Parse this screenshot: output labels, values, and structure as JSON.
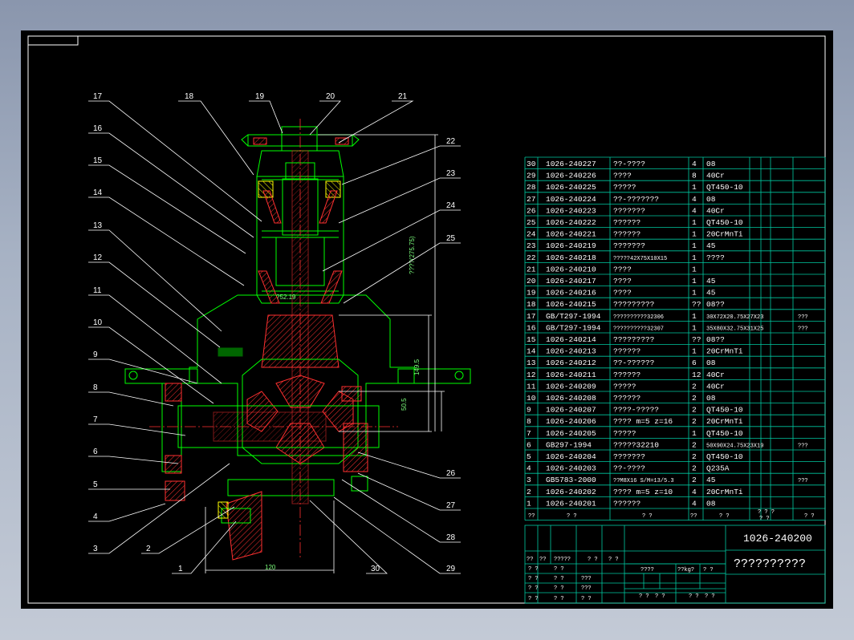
{
  "drawing": {
    "number": "1026-240200",
    "title": "??????????",
    "colors": {
      "background": "#000000",
      "frame": "#ffffff",
      "parts": "#00ff00",
      "hatch": "#ff3030",
      "centerline": "#ff3030",
      "table": "#00c8a0",
      "dimension": "#7cff7c",
      "hatch_alt": "#ffff00"
    }
  },
  "dimensions": {
    "d1": "120",
    "d2": "50.5",
    "d3": "149.5",
    "d4": "?52.19",
    "d5": "????(275.75)"
  },
  "leader_labels": [
    "1",
    "2",
    "3",
    "4",
    "5",
    "6",
    "7",
    "8",
    "9",
    "10",
    "11",
    "12",
    "13",
    "14",
    "15",
    "16",
    "17",
    "18",
    "19",
    "20",
    "21",
    "22",
    "23",
    "24",
    "25",
    "26",
    "27",
    "28",
    "29",
    "30"
  ],
  "bom": {
    "rows": [
      {
        "no": "30",
        "code": "1026-240227",
        "name": "??-????",
        "qty": "4",
        "mat": "08",
        "note": ""
      },
      {
        "no": "29",
        "code": "1026-240226",
        "name": "????",
        "qty": "8",
        "mat": "40Cr",
        "note": ""
      },
      {
        "no": "28",
        "code": "1026-240225",
        "name": "?????",
        "qty": "1",
        "mat": "QT450-10",
        "note": ""
      },
      {
        "no": "27",
        "code": "1026-240224",
        "name": "??-???????",
        "qty": "4",
        "mat": "08",
        "note": ""
      },
      {
        "no": "26",
        "code": "1026-240223",
        "name": "???????",
        "qty": "4",
        "mat": "40Cr",
        "note": ""
      },
      {
        "no": "25",
        "code": "1026-240222",
        "name": "??????",
        "qty": "1",
        "mat": "QT450-10",
        "note": ""
      },
      {
        "no": "24",
        "code": "1026-240221",
        "name": "??????",
        "qty": "1",
        "mat": "20CrMnTi",
        "note": ""
      },
      {
        "no": "23",
        "code": "1026-240219",
        "name": "???????",
        "qty": "1",
        "mat": "45",
        "note": ""
      },
      {
        "no": "22",
        "code": "1026-240218",
        "name": "?????42X75X10X15",
        "qty": "1",
        "mat": "????",
        "note": ""
      },
      {
        "no": "21",
        "code": "1026-240210",
        "name": "????",
        "qty": "1",
        "mat": "",
        "note": ""
      },
      {
        "no": "20",
        "code": "1026-240217",
        "name": "????",
        "qty": "1",
        "mat": "45",
        "note": ""
      },
      {
        "no": "19",
        "code": "1026-240216",
        "name": "????",
        "qty": "1",
        "mat": "45",
        "note": ""
      },
      {
        "no": "18",
        "code": "1026-240215",
        "name": "?????????",
        "qty": "??",
        "mat": "08??",
        "note": ""
      },
      {
        "no": "17",
        "code": "GB/T297-1994",
        "name": "??????????32306",
        "qty": "1",
        "mat": "30X72X20.75X27X23",
        "note": "???"
      },
      {
        "no": "16",
        "code": "GB/T297-1994",
        "name": "??????????32307",
        "qty": "1",
        "mat": "35X80X32.75X31X25",
        "note": "???"
      },
      {
        "no": "15",
        "code": "1026-240214",
        "name": "?????????",
        "qty": "??",
        "mat": "08??",
        "note": ""
      },
      {
        "no": "14",
        "code": "1026-240213",
        "name": "??????",
        "qty": "1",
        "mat": "20CrMnTi",
        "note": ""
      },
      {
        "no": "13",
        "code": "1026-240212",
        "name": "??-??????",
        "qty": "6",
        "mat": "08",
        "note": ""
      },
      {
        "no": "12",
        "code": "1026-240211",
        "name": "??????",
        "qty": "12",
        "mat": "40Cr",
        "note": ""
      },
      {
        "no": "11",
        "code": "1026-240209",
        "name": "?????",
        "qty": "2",
        "mat": "40Cr",
        "note": ""
      },
      {
        "no": "10",
        "code": "1026-240208",
        "name": "??????",
        "qty": "2",
        "mat": "08",
        "note": ""
      },
      {
        "no": "9",
        "code": "1026-240207",
        "name": "????-?????",
        "qty": "2",
        "mat": "QT450-10",
        "note": ""
      },
      {
        "no": "8",
        "code": "1026-240206",
        "name": "???? m=5  z=16",
        "qty": "2",
        "mat": "20CrMnTi",
        "note": ""
      },
      {
        "no": "7",
        "code": "1026-240205",
        "name": "?????",
        "qty": "1",
        "mat": "QT450-10",
        "note": ""
      },
      {
        "no": "6",
        "code": "GB297-1994",
        "name": "?????32210",
        "qty": "2",
        "mat": "50X90X24.75X23X19",
        "note": "???"
      },
      {
        "no": "5",
        "code": "1026-240204",
        "name": "???????",
        "qty": "2",
        "mat": "QT450-10",
        "note": ""
      },
      {
        "no": "4",
        "code": "1026-240203",
        "name": "??-????",
        "qty": "2",
        "mat": "Q235A",
        "note": ""
      },
      {
        "no": "3",
        "code": "GB5783-2000",
        "name": "??M8X16  S/M=13/5.3",
        "qty": "2",
        "mat": "45",
        "note": "???"
      },
      {
        "no": "2",
        "code": "1026-240202",
        "name": "???? m=5  z=10",
        "qty": "4",
        "mat": "20CrMnTi",
        "note": ""
      },
      {
        "no": "1",
        "code": "1026-240201",
        "name": "??????",
        "qty": "4",
        "mat": "08",
        "note": ""
      }
    ],
    "header": {
      "no": "??",
      "code": "?  ?",
      "name": "?  ?",
      "qty": "??",
      "mat": "?  ?",
      "extra": "? ? ?\n?  ?",
      "note": "?  ?"
    }
  },
  "titleblock": {
    "r1": [
      "??",
      "??",
      "?????",
      "?  ?",
      "?  ?"
    ],
    "r2": [
      "?  ?",
      "?  ?",
      "???"
    ],
    "r3": [
      "?  ?",
      "?  ?",
      "???"
    ],
    "r4": [
      "?  ?",
      "?  ?",
      "?  ?"
    ],
    "r5": [
      "?  ?",
      "?  ?",
      "?  ?"
    ],
    "stage": "????",
    "weight": "??kg?",
    "scale": "?  ?",
    "sheet1": "?  ?",
    "sheet2": "?  ?",
    "sheet3": "?  ?",
    "sheet4": "?  ?"
  }
}
